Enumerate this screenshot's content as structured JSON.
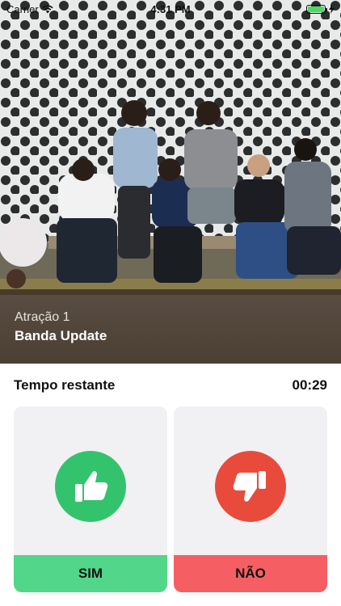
{
  "status_bar": {
    "carrier": "Carrier",
    "time": "4:31 PM",
    "battery_level": 1.0,
    "icons": [
      "wifi-icon",
      "battery-icon",
      "charging-icon"
    ]
  },
  "attraction": {
    "subtitle": "Atração 1",
    "title": "Banda Update"
  },
  "timer": {
    "label": "Tempo restante",
    "value": "00:29"
  },
  "vote": {
    "yes": {
      "label": "SIM",
      "icon": "thumbs-up-icon",
      "color": "#33c36d",
      "bar_color": "#52d68a"
    },
    "no": {
      "label": "NÃO",
      "icon": "thumbs-down-icon",
      "color": "#e84b3c",
      "bar_color": "#f55f63"
    }
  }
}
